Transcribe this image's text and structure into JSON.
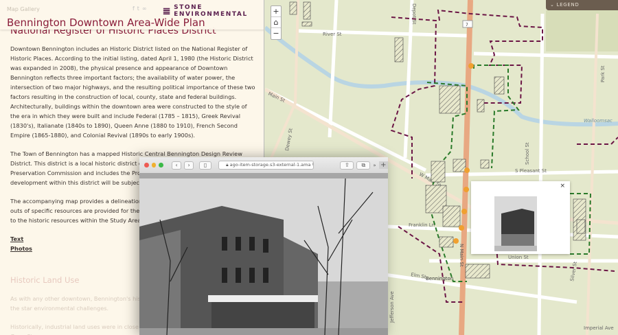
{
  "header": {
    "gallery_link": "Map Gallery",
    "brand": "Stone Environmental",
    "title": "Bennington Downtown Area-Wide Plan",
    "social_icons": [
      "facebook-icon",
      "twitter-icon",
      "link-icon"
    ]
  },
  "content": {
    "section_title": "National Register of Historic Places District",
    "paragraphs": [
      "Downtown Bennington includes an Historic District listed on the National Register of Historic Places. According to the initial listing, dated April 1, 1980 (the Historic District was expanded in 2008), the physical presence and appearance of Downtown Bennington reflects three important factors; the availability of water power, the intersection of two major highways, and the resulting political importance of these two factors resulting in the construction of local, county, state and federal buildings. Architecturally, buildings within the downtown area were constructed to the style of the era in which they were built and include Federal (1785 – 1815), Greek Revival (1830's), Italianate (1840s to 1890), Queen Anne (1880 to 1910), French Second Empire (1865-1880), and Colonial Revival (1890s to early 1900s).",
      "The Town of Bennington has a mapped Historic Central Bennington Design Review District. This district is a local historic district developed by the Bennington Historic Preservation Commission and includes the Project Area in its entirety. As part of the T",
      "development within this district will be subject to desig",
      "The accompanying map provides a delineation of the h",
      "outs of specific resources are provided for the user. Se",
      "to the historic resources within the Study Area."
    ],
    "links": [
      "Text",
      "Photos"
    ],
    "next_section_title": "Historic Land Use",
    "next_paragraphs": [
      "As with any other downtown, Bennington's hist practices that, although complying with the star environmental challenges.",
      "Historically, industrial land uses were in close p the Eveready Battery property at 401 Gage Stre"
    ]
  },
  "map": {
    "legend": "LEGEND",
    "zoom_in": "+",
    "zoom_out": "−",
    "home_icon": "home-icon",
    "route": "7",
    "streets": [
      "River St",
      "Main St",
      "Dewey St",
      "Depot St",
      "School St",
      "Park St",
      "S Pleasant St",
      "W Main St",
      "Franklin Ln",
      "Union St",
      "Elm St",
      "Silver St",
      "Jefferson Ave",
      "Imperial Ave",
      "N Main St",
      "Bennington",
      "Walloomsac"
    ]
  },
  "popup": {
    "close": "×"
  },
  "browser": {
    "url": "ago-item-storage.s3-external-1.ama",
    "more": "»",
    "new_tab": "+"
  },
  "colors": {
    "accent": "#8a1d3a",
    "local_district": "#6b1545",
    "nrhp_district": "#2a7a2a",
    "route": "#e8a882",
    "marker": "#f0a030"
  }
}
